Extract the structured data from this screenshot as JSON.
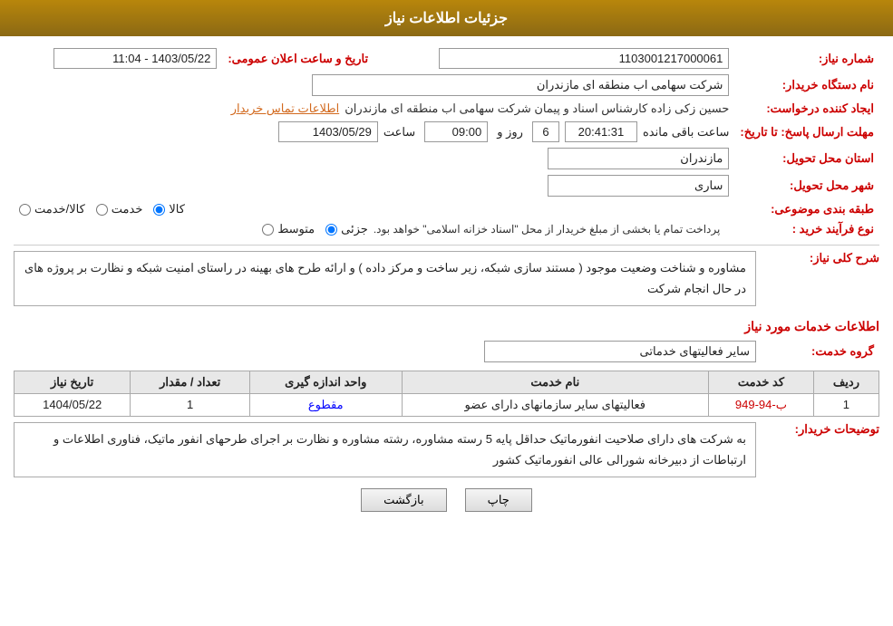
{
  "header": {
    "title": "جزئیات اطلاعات نیاز"
  },
  "fields": {
    "shomareNiaz_label": "شماره نیاز:",
    "shomareNiaz_value": "1103001217000061",
    "namDastgah_label": "نام دستگاه خریدار:",
    "namDastgah_value": "شرکت سهامی اب منطقه ای مازندران",
    "ijadKonande_label": "ایجاد کننده درخواست:",
    "ijadKonande_person": "حسین زکی زاده کارشناس اسناد و پیمان شرکت سهامی اب منطقه ای مازندران",
    "ijadKonande_link": "اطلاعات تماس خریدار",
    "mohlat_label": "مهلت ارسال پاسخ: تا تاریخ:",
    "mohlat_date": "1403/05/29",
    "mohlat_saat_label": "ساعت",
    "mohlat_saat": "09:00",
    "mohlat_roz_label": "روز و",
    "mohlat_roz": "6",
    "mohlat_baqi": "20:41:31",
    "mohlat_baqi_label": "ساعت باقی مانده",
    "ostan_label": "استان محل تحویل:",
    "ostan_value": "مازندران",
    "shahr_label": "شهر محل تحویل:",
    "shahr_value": "ساری",
    "tabaqe_label": "طبقه بندی موضوعی:",
    "tabaqe_kala": "کالا",
    "tabaqe_khadamat": "خدمت",
    "tabaqe_kala_khadamat": "کالا/خدمت",
    "tarikh_label": "تاریخ و ساعت اعلان عمومی:",
    "tarikh_value": "1403/05/22 - 11:04",
    "noeFarayand_label": "نوع فرآیند خرید :",
    "noeFarayand_jozii": "جزئی",
    "noeFarayand_motavaset": "متوسط",
    "noeFarayand_note": "پرداخت تمام یا بخشی از مبلغ خریدار از محل \"اسناد خزانه اسلامی\" خواهد بود.",
    "sharhKoli_label": "شرح کلی نیاز:",
    "sharhKoli_value": "مشاوره و شناخت وضعیت موجود ( مستند سازی شبکه، زیر ساخت و مرکز داده ) و ارائه طرح های بهینه در راستای امنیت شبکه و نظارت بر پروژه های در حال انجام شرکت",
    "khadamat_label": "اطلاعات خدمات مورد نیاز",
    "geroh_label": "گروه خدمت:",
    "geroh_value": "سایر فعالیتهای خدماتی",
    "table": {
      "headers": [
        "ردیف",
        "کد خدمت",
        "نام خدمت",
        "واحد اندازه گیری",
        "تعداد / مقدار",
        "تاریخ نیاز"
      ],
      "rows": [
        {
          "radif": "1",
          "kod": "ب-94-949",
          "nam": "فعالیتهای سایر سازمانهای دارای عضو",
          "vahed": "مقطوع",
          "tedad": "1",
          "tarikh": "1404/05/22"
        }
      ]
    },
    "tozihat_label": "توضیحات خریدار:",
    "tozihat_value": "به شرکت های دارای صلاحیت انفورماتیک حداقل پایه 5 رسته مشاوره، رشته مشاوره و نظارت بر اجرای طرحهای انفور ماتیک، فناوری اطلاعات و ارتباطات از دبیرخانه شورالی عالی انفورماتیک کشور"
  },
  "buttons": {
    "chap": "چاپ",
    "bazgasht": "بازگشت"
  }
}
